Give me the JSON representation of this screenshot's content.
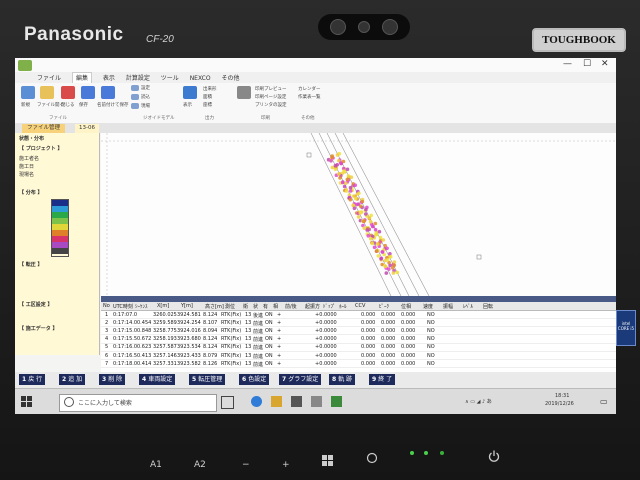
{
  "device": {
    "brand": "Panasonic",
    "model": "CF-20",
    "badge": "TOUGHBOOK",
    "hw_keys": [
      "A1",
      "A2",
      "−",
      "+"
    ]
  },
  "app": {
    "menu": [
      "ファイル",
      "編集",
      "表示",
      "計算設定",
      "ツール",
      "NEXCO",
      "その他"
    ],
    "ribbon_groups": [
      "ファイル",
      "ジオイドモデル",
      "出力",
      "印刷",
      "その他"
    ],
    "ribbon_items": [
      "新規",
      "ファイル開く",
      "保存",
      "閉じる",
      "名前付けて保存",
      "設定",
      "読込",
      "現場",
      "表示",
      "出来形",
      "面積",
      "座標",
      "印刷プレビュー",
      "印刷ページ設定",
      "プリンタの設定",
      "カレンダー",
      "作業表一覧"
    ],
    "file_tab": "ファイル管理",
    "file_tab2": "13-06",
    "left_panel": {
      "title": "状態・分布",
      "lines": [
        "【 プロジェクト 】",
        "施工者名",
        "施工日",
        "現場名",
        "【 分布 】",
        "【 転圧 】",
        "【 工区設定 】",
        "【 施工データ 】"
      ]
    },
    "swatches": [
      "#1a2f8a",
      "#2d9bd6",
      "#2aa84a",
      "#7fc24a",
      "#e0d63a",
      "#e07f2a",
      "#d6336c",
      "#a84ac2",
      "#444444"
    ],
    "table": {
      "headers": [
        "No",
        "UTC時刻",
        "ｼｰｹﾝｽ",
        "X[m]",
        "Y[m]",
        "高さ[m]",
        "測位",
        "衛",
        "状",
        "有",
        "相",
        "前/後",
        "起振方",
        "ﾄﾞｯﾌﾟ",
        "ﾎｰﾙ",
        "CCV",
        "ﾋﾟｰｸ",
        "位相",
        "速度",
        "振幅",
        "ﾚﾍﾞﾙ",
        "回転"
      ],
      "rows": [
        [
          "1",
          "0:17:07.0",
          "",
          "3260.025",
          "3924.581",
          "8.124",
          "RTK(Fix)",
          "13",
          "後進",
          "ON",
          "+",
          "+0.0000",
          "0.000",
          "0.000",
          "0.000",
          "NO"
        ],
        [
          "2",
          "0:17:14.0",
          "0.454",
          "3259.589",
          "3924.254",
          "8.107",
          "RTK(Fix)",
          "13",
          "前進",
          "ON",
          "+",
          "+0.0000",
          "0.000",
          "0.000",
          "0.000",
          "NO"
        ],
        [
          "3",
          "0:17:15.0",
          "0.848",
          "3258.775",
          "3924.016",
          "8.094",
          "RTK(Fix)",
          "13",
          "前進",
          "ON",
          "+",
          "+0.0000",
          "0.000",
          "0.000",
          "0.000",
          "NO"
        ],
        [
          "4",
          "0:17:15.5",
          "0.672",
          "3258.193",
          "3923.680",
          "8.124",
          "RTK(Fix)",
          "13",
          "前進",
          "ON",
          "+",
          "+0.0000",
          "0.000",
          "0.000",
          "0.000",
          "NO"
        ],
        [
          "5",
          "0:17:16.0",
          "0.623",
          "3257.587",
          "3923.534",
          "8.124",
          "RTK(Fix)",
          "13",
          "前進",
          "ON",
          "+",
          "+0.0000",
          "0.000",
          "0.000",
          "0.000",
          "NO"
        ],
        [
          "6",
          "0:17:16.5",
          "0.413",
          "3257.146",
          "3923.433",
          "8.079",
          "RTK(Fix)",
          "13",
          "前進",
          "ON",
          "+",
          "+0.0000",
          "0.000",
          "0.000",
          "0.000",
          "NO"
        ],
        [
          "7",
          "0:17:18.0",
          "0.414",
          "3257.331",
          "3923.582",
          "8.126",
          "RTK(Fix)",
          "13",
          "前進",
          "ON",
          "+",
          "+0.0000",
          "0.000",
          "0.000",
          "0.000",
          "NO"
        ]
      ]
    },
    "fkeys": [
      {
        "num": "1",
        "label": "戻 行"
      },
      {
        "num": "2",
        "label": "追 加"
      },
      {
        "num": "3",
        "label": "削 除"
      },
      {
        "num": "4",
        "label": "車両設定"
      },
      {
        "num": "5",
        "label": "転圧管理"
      },
      {
        "num": "6",
        "label": "色設定"
      },
      {
        "num": "7",
        "label": "グラフ設定"
      },
      {
        "num": "8",
        "label": "軌 跡"
      },
      {
        "num": "9",
        "label": "終 了"
      }
    ]
  },
  "taskbar": {
    "search_placeholder": "ここに入力して検索",
    "clock_time": "18:31",
    "clock_date": "2019/12/26"
  },
  "sticker": "intel CORE i5"
}
